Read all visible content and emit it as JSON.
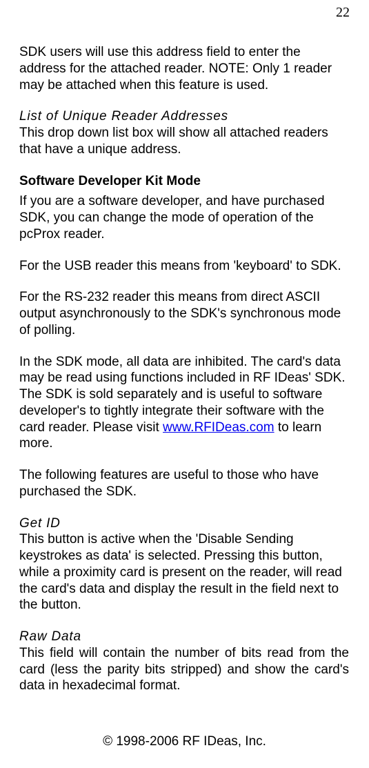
{
  "page_number": "22",
  "para1": "SDK users will use this address field to enter the address for the attached reader. NOTE: Only 1 reader may be attached when this feature is used.",
  "heading_list_unique": "List of Unique Reader Addresses",
  "para2": "This drop down list box will show all attached readers that have a unique address.",
  "heading_sdk_mode": "Software Developer Kit Mode",
  "para3": "If you are a software developer, and have purchased SDK, you can change the mode of operation of the pcProx reader.",
  "para4": "For the USB reader this means from 'keyboard' to SDK.",
  "para5": "For the RS-232 reader this means from direct ASCII output asynchronously to the SDK's synchronous mode of polling.",
  "para6_pre": "In the SDK mode, all data are inhibited. The card's data may be read using functions included in RF IDeas' SDK. The SDK is sold separately and is useful to software developer's to tightly integrate their software with the card reader. Please visit ",
  "link_text": "www.RFIDeas.com",
  "para6_post": " to learn more.",
  "para7": "The following features are useful to those who have purchased the SDK.",
  "heading_get_id": "Get ID",
  "para8": "This button is active when the 'Disable Sending keystrokes as data' is selected. Pressing this button, while a proximity card is present on the reader, will read the card's data and display the result in the field next to the button.",
  "heading_raw_data": "Raw Data",
  "para9": "This field will contain the number of bits read from the card (less the parity bits stripped) and show the card's data in hexadecimal format.",
  "footer": "© 1998-2006 RF IDeas, Inc."
}
